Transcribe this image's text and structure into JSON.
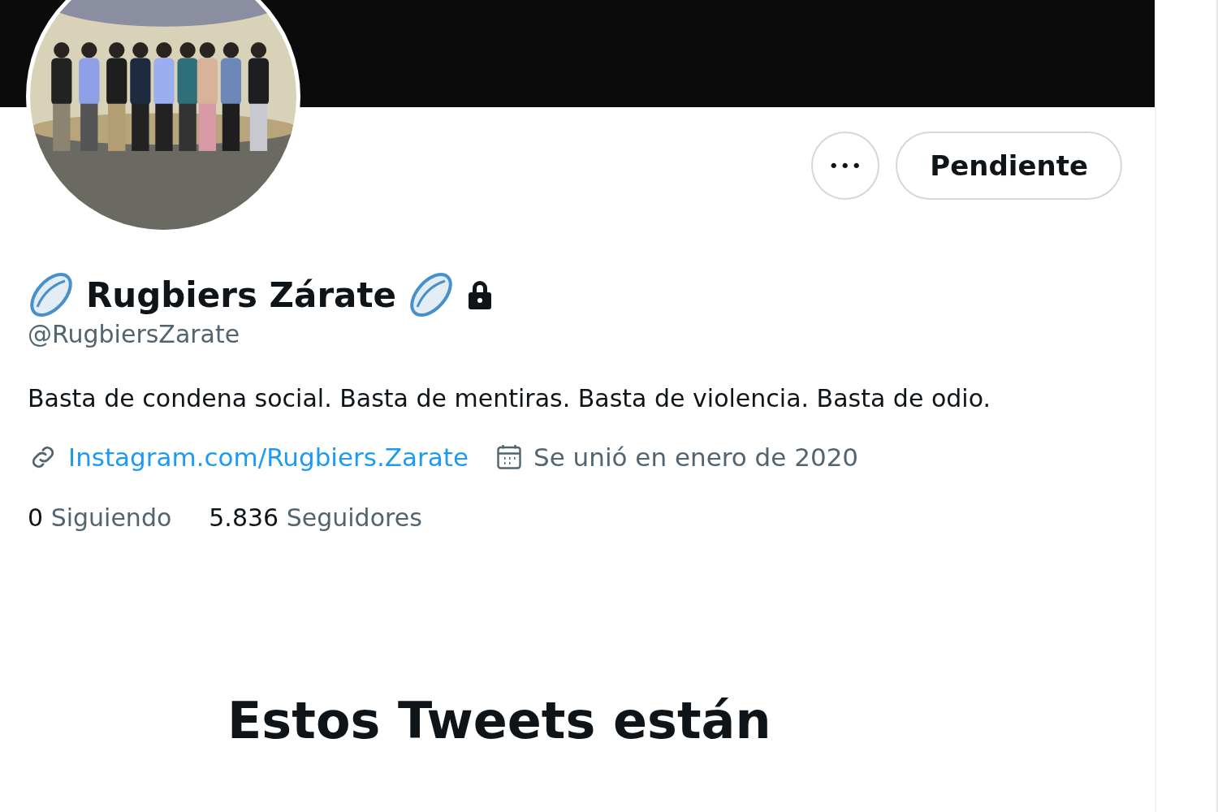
{
  "profile": {
    "name": "Rugbiers Zárate",
    "protected": true,
    "handle": "@RugbiersZarate",
    "bio": "Basta de condena social. Basta de mentiras. Basta de violencia. Basta de odio.",
    "website": "Instagram.com/Rugbiers.Zarate",
    "joined": "Se unió en enero de 2020",
    "stats": [
      {
        "count": "0",
        "label": "Siguiendo"
      },
      {
        "count": "5.836",
        "label": "Seguidores"
      }
    ]
  },
  "actions": {
    "more": "•••",
    "follow_button": "Pendiente"
  },
  "notice": {
    "title": "Estos Tweets están"
  }
}
